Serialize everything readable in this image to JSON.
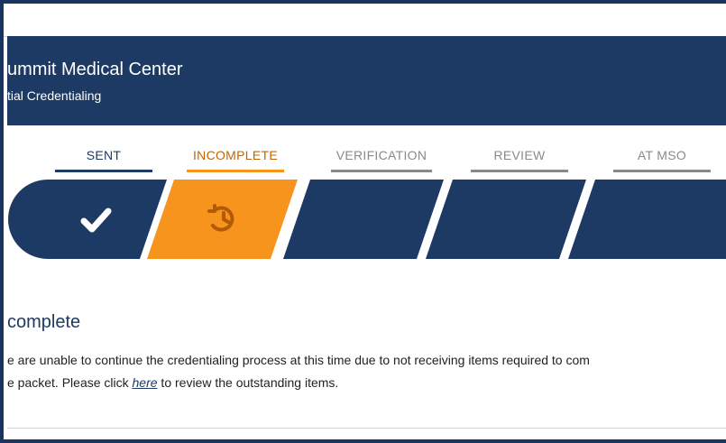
{
  "header": {
    "org_name": "ummit Medical Center",
    "subtitle": "tial Credentialing"
  },
  "steps": [
    {
      "label": "SENT",
      "state": "complete",
      "icon": "checkmark-icon"
    },
    {
      "label": "INCOMPLETE",
      "state": "current",
      "icon": "history-clock-icon"
    },
    {
      "label": "VERIFICATION",
      "state": "pending"
    },
    {
      "label": "REVIEW",
      "state": "pending"
    },
    {
      "label": "AT MSO",
      "state": "pending"
    }
  ],
  "status": {
    "title": "complete",
    "line1": "e are unable to continue the credentialing process at this time due to not receiving items required to com",
    "line2_before": "e packet. Please click ",
    "link_text": "here",
    "line2_after": " to review the outstanding items."
  },
  "colors": {
    "navy": "#1d3a64",
    "orange": "#f7941d",
    "orange_text": "#c0650a",
    "gray": "#8a8a8a",
    "white": "#ffffff"
  }
}
